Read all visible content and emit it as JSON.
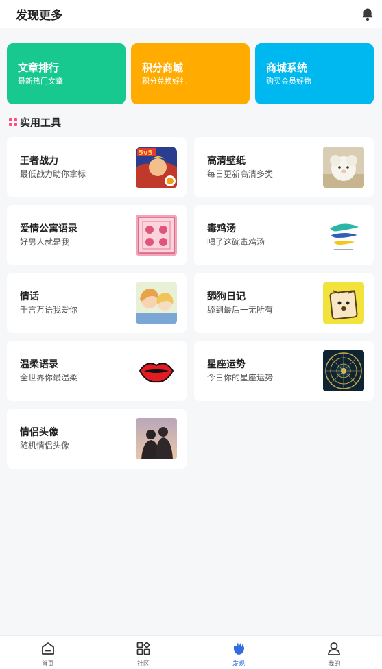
{
  "header": {
    "title": "发现更多",
    "bell_icon": "bell-icon"
  },
  "promos": [
    {
      "title": "文章排行",
      "subtitle": "最新热门文章",
      "color": "#17c98f"
    },
    {
      "title": "积分商城",
      "subtitle": "积分兑换好礼",
      "color": "#ffab00"
    },
    {
      "title": "商城系统",
      "subtitle": "购买会员好物",
      "color": "#00b8f0"
    }
  ],
  "section": {
    "title": "实用工具",
    "icon_color": "#ff4d7d"
  },
  "tools": [
    {
      "title": "王者战力",
      "subtitle": "最低战力助你拿标",
      "thumb": "game-hero-thumbnail"
    },
    {
      "title": "高清壁纸",
      "subtitle": "每日更新高清多类",
      "thumb": "plush-toy-thumbnail"
    },
    {
      "title": "爱情公寓语录",
      "subtitle": "好男人就是我",
      "thumb": "love-apartment-thumbnail"
    },
    {
      "title": "毒鸡汤",
      "subtitle": "喝了这碗毒鸡汤",
      "thumb": "swirl-logo-thumbnail"
    },
    {
      "title": "情话",
      "subtitle": "千言万语我爱你",
      "thumb": "anime-couple-thumbnail"
    },
    {
      "title": "舔狗日记",
      "subtitle": "舔到最后一无所有",
      "thumb": "dog-sticker-thumbnail"
    },
    {
      "title": "温柔语录",
      "subtitle": "全世界你最温柔",
      "thumb": "red-lips-thumbnail"
    },
    {
      "title": "星座运势",
      "subtitle": "今日你的星座运势",
      "thumb": "zodiac-wheel-thumbnail"
    },
    {
      "title": "情侣头像",
      "subtitle": "随机情侣头像",
      "thumb": "couple-silhouette-thumbnail"
    }
  ],
  "tabbar": {
    "active_color": "#2f6de1",
    "items": [
      {
        "label": "首页",
        "icon": "home-icon"
      },
      {
        "label": "社区",
        "icon": "grid-icon"
      },
      {
        "label": "发现",
        "icon": "discover-icon",
        "active": true
      },
      {
        "label": "我的",
        "icon": "user-icon"
      }
    ]
  }
}
